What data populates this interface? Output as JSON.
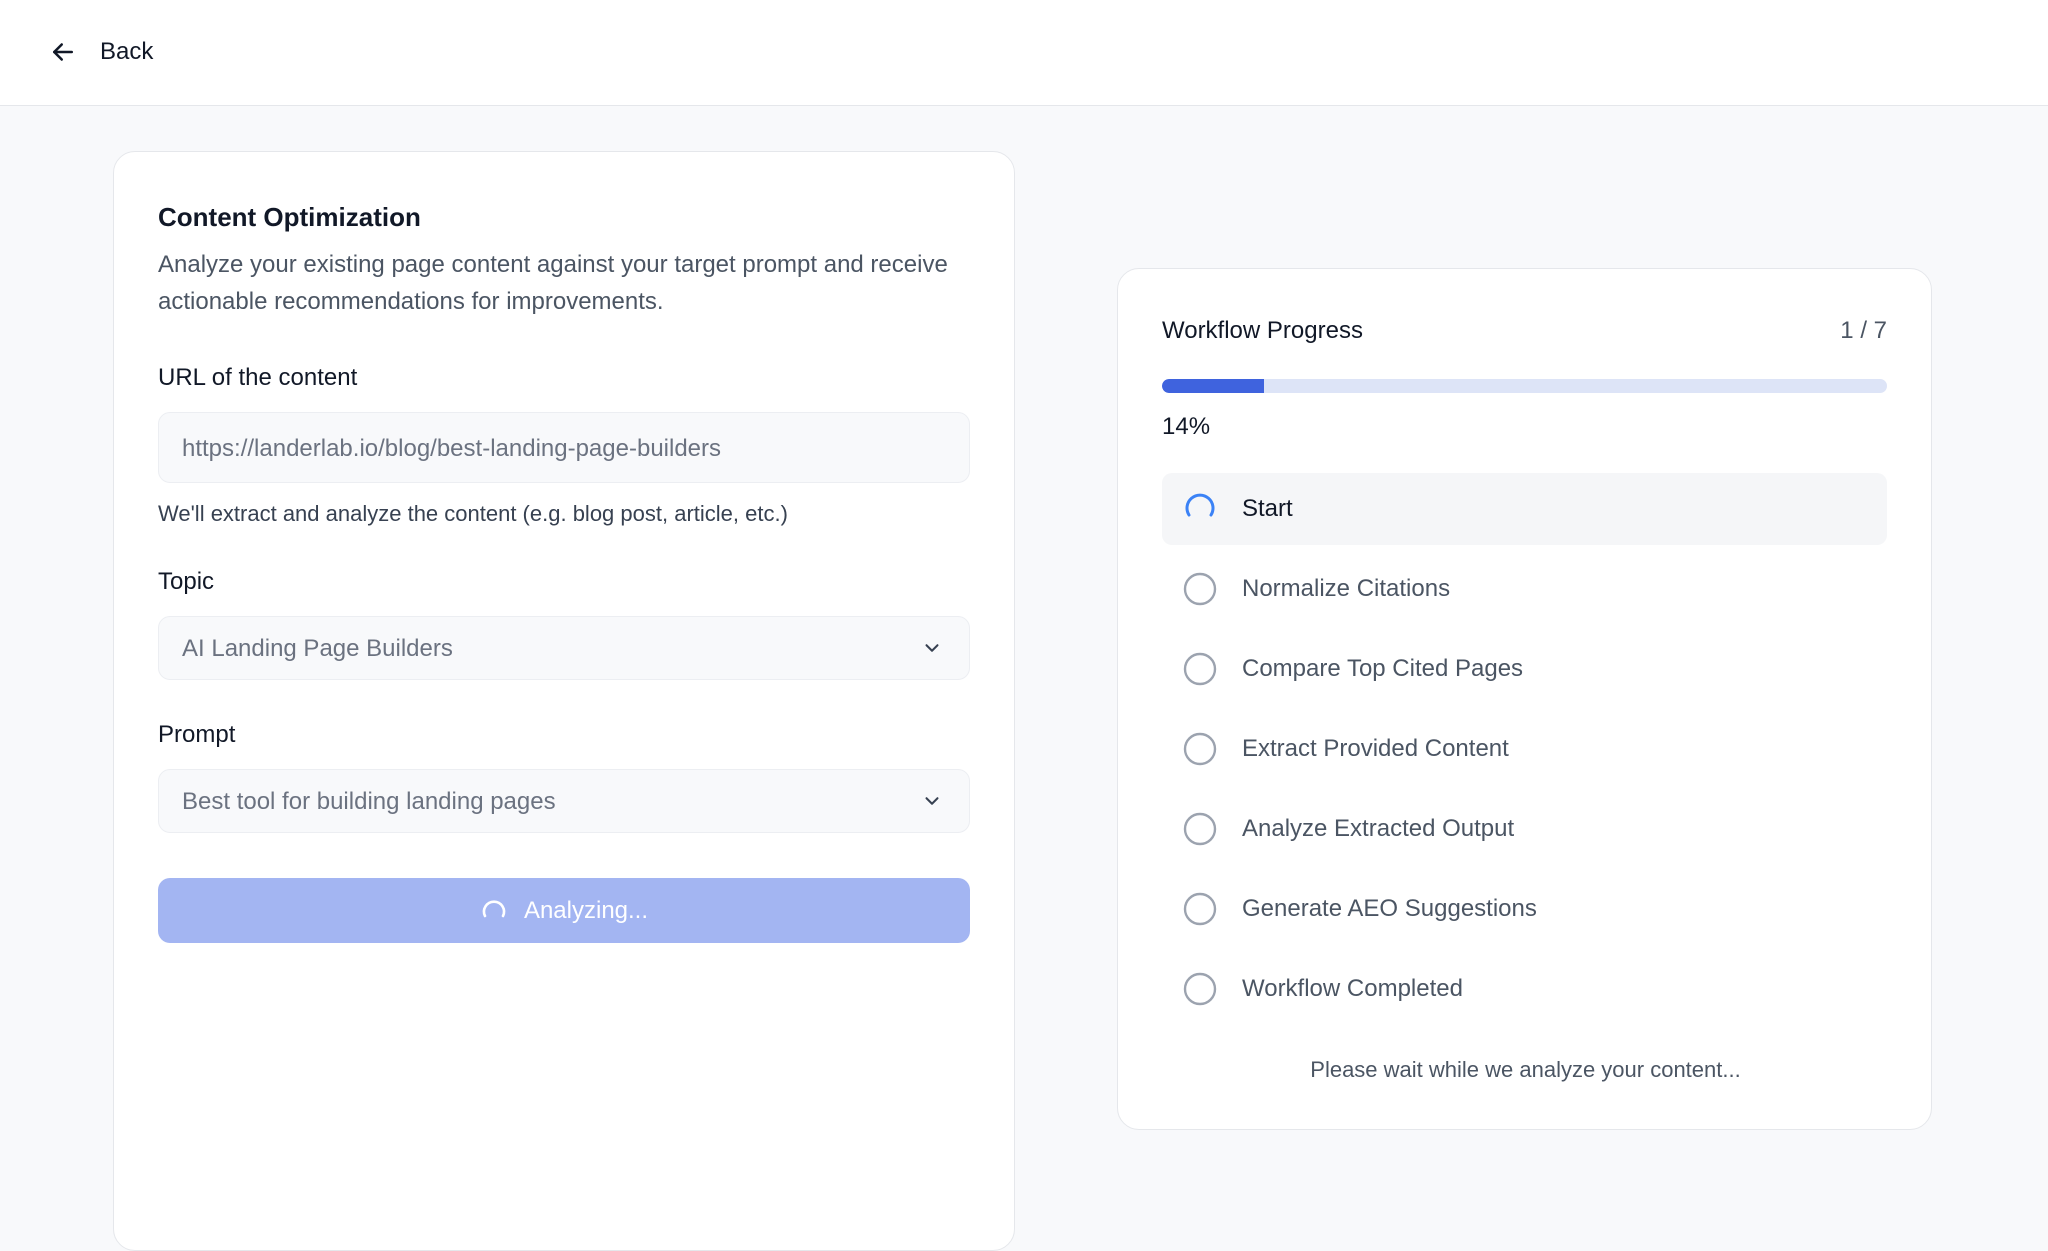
{
  "header": {
    "back_label": "Back",
    "back_icon": "arrow-left-icon"
  },
  "form": {
    "title": "Content Optimization",
    "description": "Analyze your existing page content against your target prompt and receive actionable recommendations for improvements.",
    "url_label": "URL of the content",
    "url_value": "https://landerlab.io/blog/best-landing-page-builders",
    "url_helper": "We'll extract and analyze the content (e.g. blog post, article, etc.)",
    "topic_label": "Topic",
    "topic_value": "AI Landing Page Builders",
    "prompt_label": "Prompt",
    "prompt_value": "Best tool for building landing pages",
    "submit_label": "Analyzing...",
    "submit_icon": "spinner-icon"
  },
  "workflow": {
    "title": "Workflow Progress",
    "count": "1 / 7",
    "progress": 0.14,
    "percent_label": "14%",
    "steps": [
      {
        "label": "Start",
        "status": "in-progress"
      },
      {
        "label": "Normalize Citations",
        "status": "pending"
      },
      {
        "label": "Compare Top Cited Pages",
        "status": "pending"
      },
      {
        "label": "Extract Provided Content",
        "status": "pending"
      },
      {
        "label": "Analyze Extracted Output",
        "status": "pending"
      },
      {
        "label": "Generate AEO Suggestions",
        "status": "pending"
      },
      {
        "label": "Workflow Completed",
        "status": "pending"
      }
    ],
    "wait_message": "Please wait while we analyze your content..."
  },
  "colors": {
    "accent": "#3f63de",
    "button_disabled": "#a3b5f2",
    "track": "#dde4f7",
    "spinner": "#3b82f6"
  }
}
